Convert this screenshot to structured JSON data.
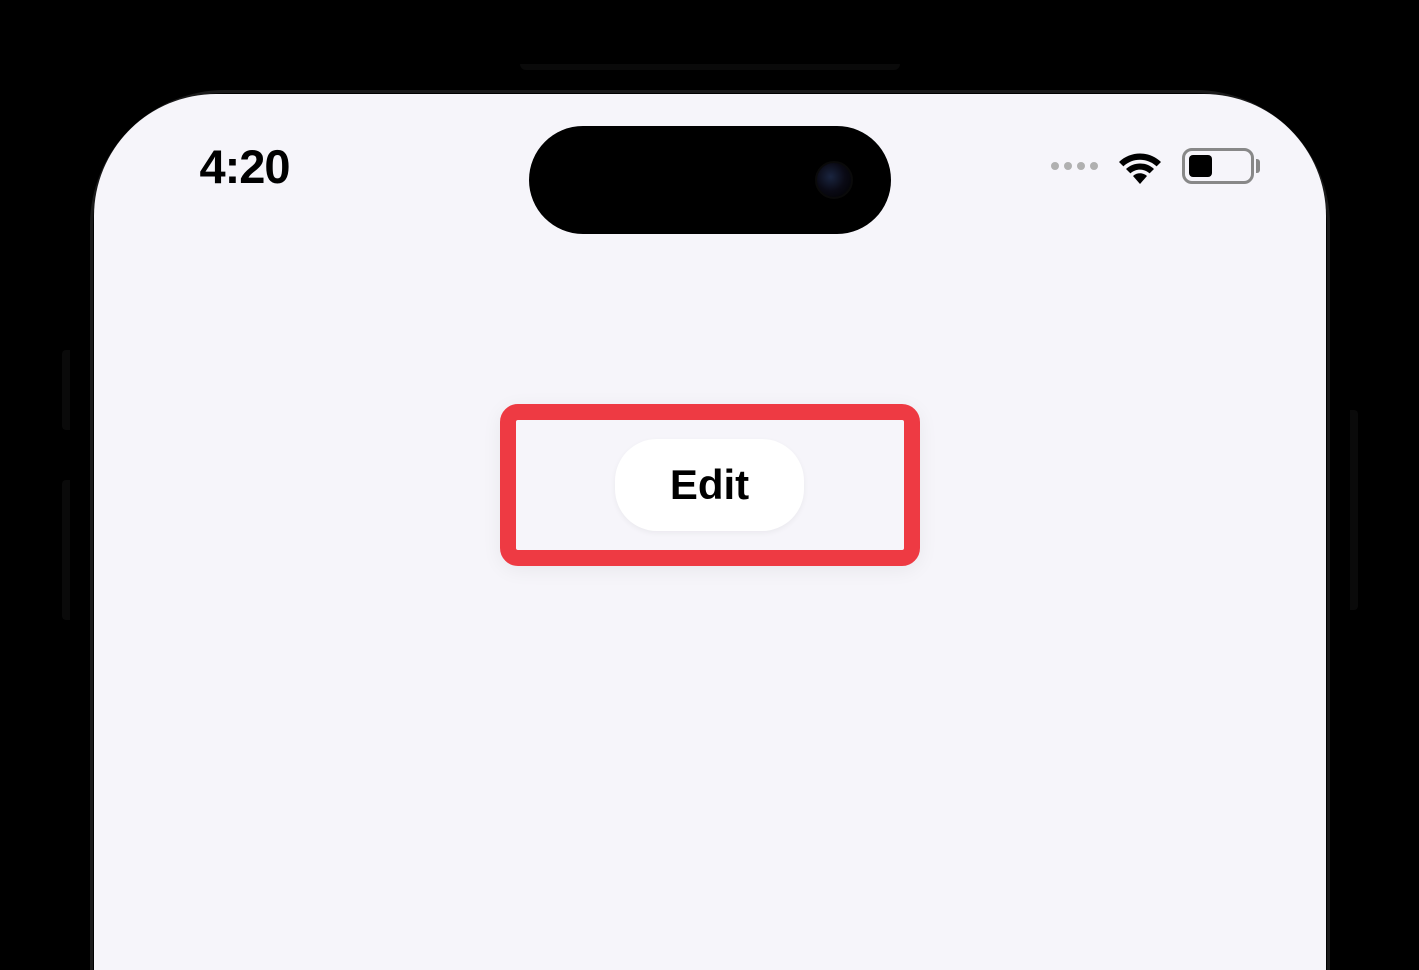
{
  "status_bar": {
    "time": "4:20"
  },
  "content": {
    "edit_button_label": "Edit"
  }
}
